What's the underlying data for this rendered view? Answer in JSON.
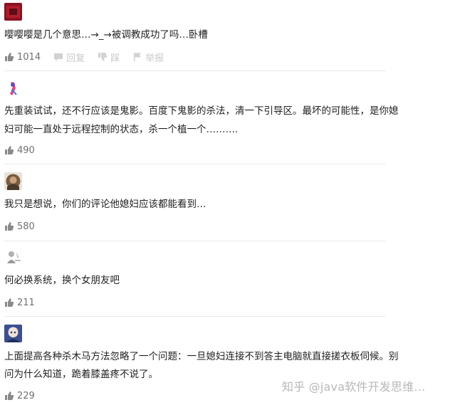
{
  "comments": [
    {
      "text": "嘤嘤嘤是几个意思…→_→被调教成功了吗…卧槽",
      "likes": "1014",
      "reply_label": "回复",
      "dislike_label": "踩",
      "report_label": "举报"
    },
    {
      "text_line1": "先重装试试，还不行应该是鬼影。百度下鬼影的杀法，清一下引导区。最坏的可能性，是你媳",
      "text_line2": "妇可能一直处于远程控制的状态，杀一个植一个……….",
      "likes": "490"
    },
    {
      "text": "我只是想说，你们的评论他媳妇应该都能看到…",
      "likes": "580"
    },
    {
      "text": "何必换系统，换个女朋友吧",
      "likes": "211"
    },
    {
      "text_line1": "上面提高各种杀木马方法忽略了一个问题：一旦媳妇连接不到答主电脑就直接搓衣板伺候。别",
      "text_line2": "问为什么知道，跪着膝盖疼不说了。",
      "likes": "229"
    }
  ],
  "watermark": "知乎 @java软件开发思维…",
  "colors": {
    "text": "#1e1e1e",
    "meta": "#6f6f6f",
    "faint": "#c9c9c9",
    "divider": "#e9e9e9"
  }
}
